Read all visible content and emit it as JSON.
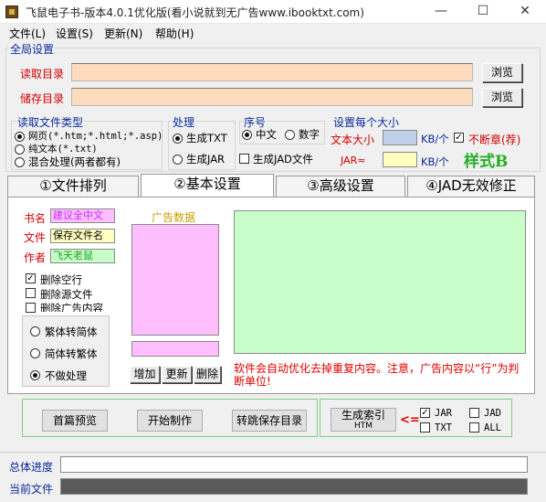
{
  "window": {
    "title": "飞鼠电子书-版本4.0.1优化版(看小说就到无广告www.ibooktxt.com)",
    "minimize": "—",
    "maximize": "☐",
    "close": "✕"
  },
  "menu": [
    "文件(L)",
    "设置(S)",
    "更新(N)",
    "帮助(H)"
  ],
  "global": {
    "title": "全局设置",
    "read_label": "读取目录",
    "read_value": "",
    "save_label": "储存目录",
    "save_value": "",
    "browse": "浏览"
  },
  "file_type": {
    "title": "读取文件类型",
    "options": [
      "网页(*.htm;*.html;*.asp)",
      "纯文本(*.txt)",
      "混合处理(两者都有)"
    ],
    "selected": 0
  },
  "process": {
    "title": "处理",
    "txt": "生成TXT",
    "jar": "生成JAR",
    "jad": "生成JAD文件"
  },
  "order": {
    "title": "序号",
    "chinese": "中文",
    "number": "数字"
  },
  "size": {
    "title": "设置每个大小",
    "text_label": "文本大小",
    "text_unit": "KB/个",
    "nobreak": "不断章(荐)",
    "jar_label": "JAR≈",
    "jar_unit": "KB/个",
    "style": "样式B"
  },
  "tabs": [
    "①文件排列",
    "②基本设置",
    "③高级设置",
    "④JAD无效修正"
  ],
  "basic": {
    "book_label": "书名",
    "book_value": "建议全中文",
    "file_label": "文件",
    "file_value": "保存文件名",
    "author_label": "作者",
    "author_value": "飞天老鼠",
    "del_blank": "删除空行",
    "del_source": "删除源文件",
    "del_ad": "删除广告内容",
    "conv_trad_simp": "繁体转简体",
    "conv_simp_trad": "简体转繁体",
    "no_conv": "不做处理",
    "ad_title": "广告数据",
    "add": "增加",
    "update": "更新",
    "delete": "删除",
    "notice": "软件会自动优化去掉重复内容。注意，广告内容以“行”为判断单位!"
  },
  "actions": {
    "preview": "首篇预览",
    "start": "开始制作",
    "jump": "转跳保存目录",
    "index": "生成索引",
    "index2": "HTM",
    "arrow": "<=",
    "jar": "JAR",
    "jad": "JAD",
    "txt": "TXT",
    "all": "ALL"
  },
  "progress": {
    "total_label": "总体进度",
    "current_label": "当前文件",
    "total": 0,
    "current": 0
  },
  "colors": {
    "peach": "#fcdcbc",
    "pink": "#ffbfff",
    "light_green": "#c8fcc8",
    "yellow": "#ffffc0",
    "blue_gray": "#c0d0e8"
  }
}
